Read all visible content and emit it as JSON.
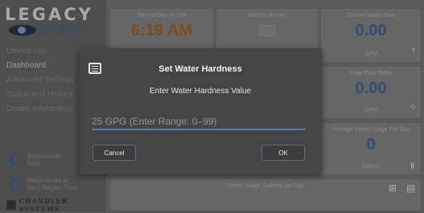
{
  "logo": {
    "top": "LEGACY",
    "bottom": "VIEW"
  },
  "sidebar": {
    "items": [
      {
        "label": "Device List"
      },
      {
        "label": "Dashboard"
      },
      {
        "label": "Advanced Settings"
      },
      {
        "label": "Status and History"
      },
      {
        "label": "Dealer Information"
      }
    ],
    "regen_now": {
      "line1": "Regenerate",
      "line2": "Now"
    },
    "regen_next": {
      "line1": "Regenerate at",
      "line2": "Next Regen Time"
    },
    "brand": "CHANDLER SYSTEMS"
  },
  "cards": {
    "time": {
      "title": "Time of Day on Unit",
      "value": "6:19 AM"
    },
    "battery": {
      "title": "Battery on Unit"
    },
    "current_flow": {
      "title": "Current Water Flow",
      "value": "0.00",
      "unit": "GPM"
    },
    "peak_flow": {
      "title": "Peak Flow Today",
      "value": "0.00",
      "unit": "GPM"
    },
    "avg_usage": {
      "title": "Average Water Usage Per Day",
      "value": "0",
      "unit": "Gallons"
    },
    "usage_chart": {
      "title": "Water Usage: Gallons per Day"
    }
  },
  "dialog": {
    "title": "Set Water Hardness",
    "subtitle": "Enter Water Hardness Value",
    "input_placeholder": "25 GPG (Enter Range: 0–99)",
    "cancel_label": "Cancel",
    "ok_label": "OK"
  },
  "colors": {
    "accent": "#5d7aa0",
    "time_value": "#7e4a1e",
    "flow_value": "#2f4f72"
  }
}
